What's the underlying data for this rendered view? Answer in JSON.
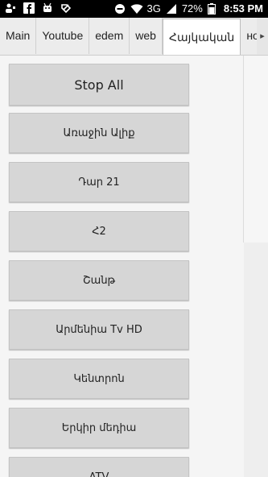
{
  "status_bar": {
    "signal": "3G",
    "battery": "72%",
    "time": "8:53 PM"
  },
  "tabs": [
    {
      "label": "Main"
    },
    {
      "label": "Youtube"
    },
    {
      "label": "edem"
    },
    {
      "label": "web"
    },
    {
      "label": "Հայկական",
      "active": true
    },
    {
      "label": "нo"
    }
  ],
  "buttons": [
    {
      "label": "Stop All"
    },
    {
      "label": "Առաջին Ալիք"
    },
    {
      "label": "Դար 21"
    },
    {
      "label": "Հ2"
    },
    {
      "label": "Շանթ"
    },
    {
      "label": "Արմենիա Tv HD"
    },
    {
      "label": "Կենտրոն"
    },
    {
      "label": "Երկիր մեդիա"
    },
    {
      "label": "ATV"
    }
  ],
  "colors": {
    "status_bar_bg": "#000000",
    "button_bg": "#d6d6d6",
    "page_bg": "#f5f5f5"
  }
}
